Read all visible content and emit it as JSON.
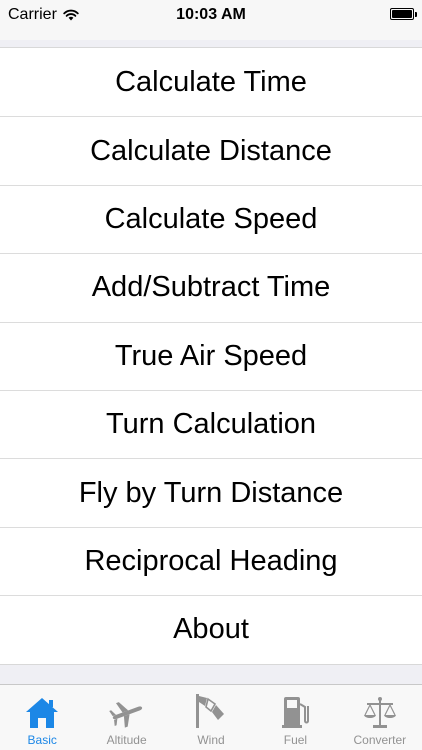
{
  "status_bar": {
    "carrier": "Carrier",
    "time": "10:03 AM",
    "battery_level": 1.0
  },
  "menu": {
    "items": [
      {
        "label": "Calculate Time"
      },
      {
        "label": "Calculate Distance"
      },
      {
        "label": "Calculate Speed"
      },
      {
        "label": "Add/Subtract Time"
      },
      {
        "label": "True Air Speed"
      },
      {
        "label": "Turn Calculation"
      },
      {
        "label": "Fly by Turn Distance"
      },
      {
        "label": "Reciprocal Heading"
      },
      {
        "label": "About"
      }
    ]
  },
  "tab_bar": {
    "active_color": "#1c87e6",
    "inactive_color": "#929292",
    "tabs": [
      {
        "label": "Basic",
        "icon": "house-icon",
        "active": true
      },
      {
        "label": "Altitude",
        "icon": "airplane-icon",
        "active": false
      },
      {
        "label": "Wind",
        "icon": "windsock-icon",
        "active": false
      },
      {
        "label": "Fuel",
        "icon": "fuel-pump-icon",
        "active": false
      },
      {
        "label": "Converter",
        "icon": "scales-icon",
        "active": false
      }
    ]
  }
}
